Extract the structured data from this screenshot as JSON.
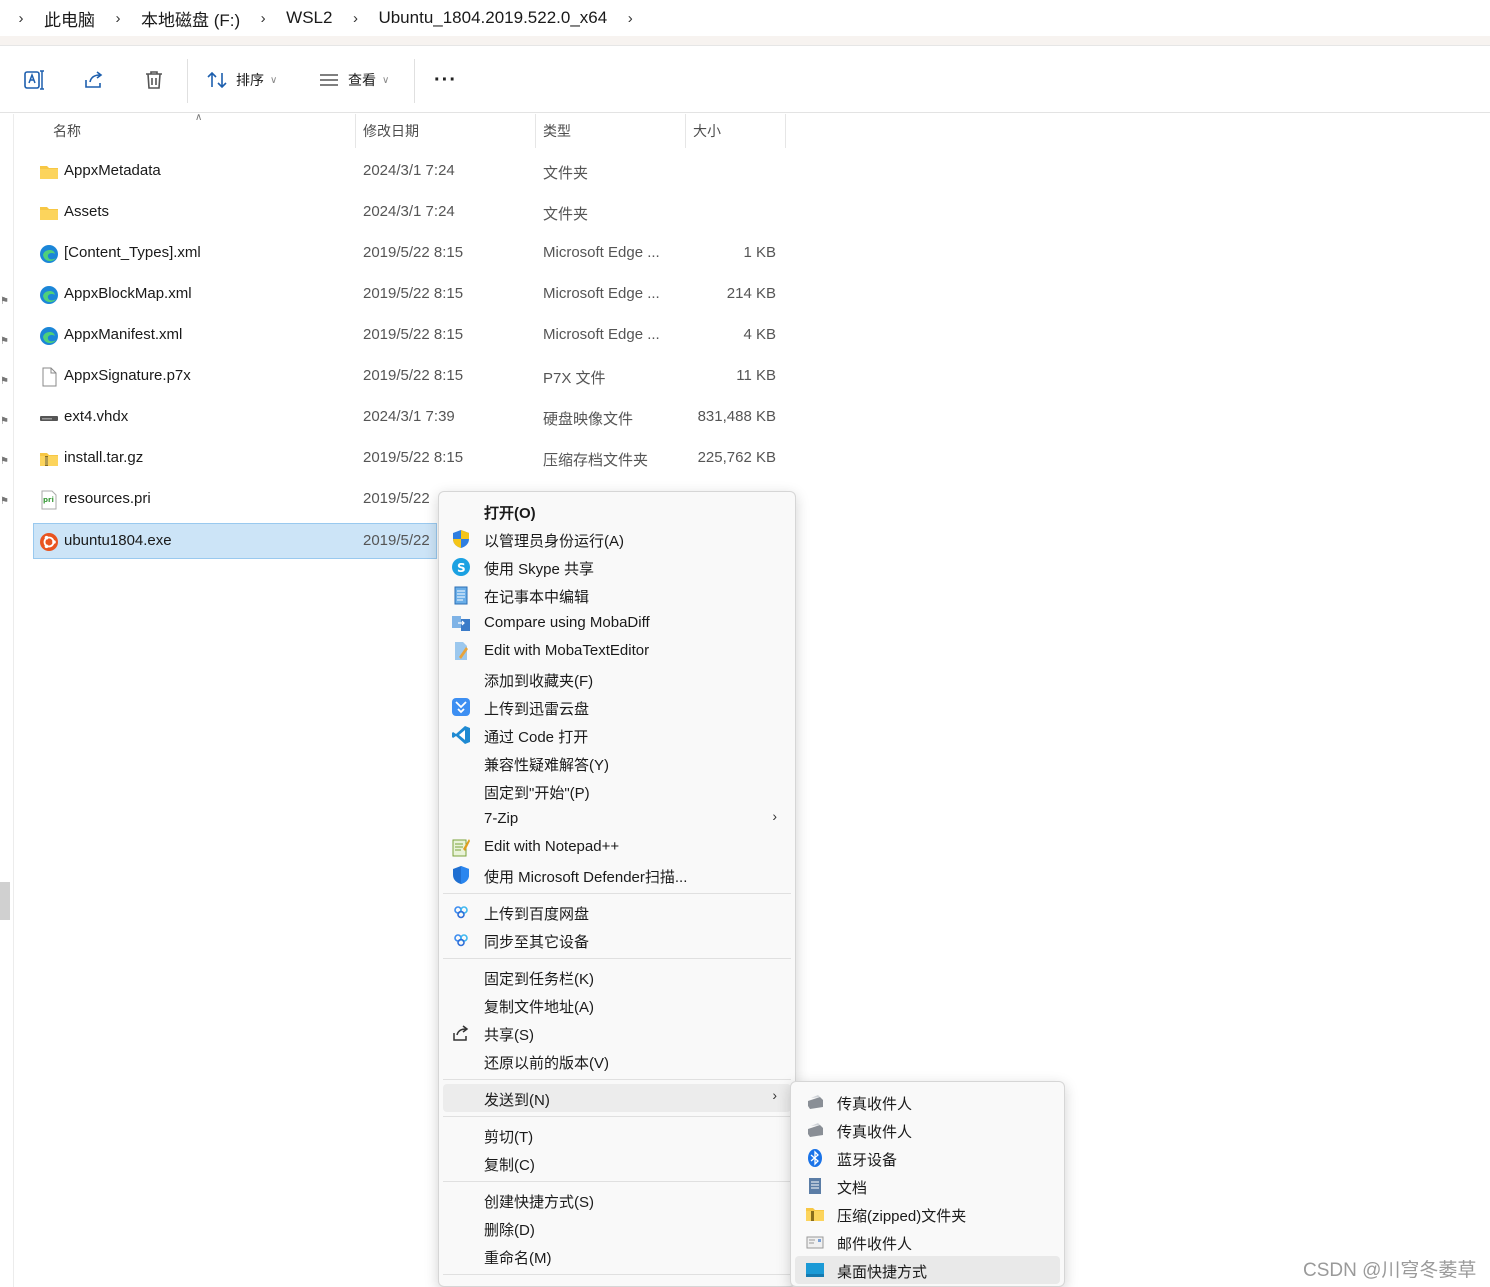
{
  "breadcrumb": {
    "items": [
      "此电脑",
      "本地磁盘 (F:)",
      "WSL2",
      "Ubuntu_1804.2019.522.0_x64"
    ]
  },
  "toolbar": {
    "sort_label": "排序",
    "view_label": "查看",
    "more_label": "···"
  },
  "columns": {
    "name": "名称",
    "date": "修改日期",
    "type": "类型",
    "size": "大小"
  },
  "files": [
    {
      "name": "AppxMetadata",
      "date": "2024/3/1 7:24",
      "type": "文件夹",
      "size": "",
      "icon": "folder-icon"
    },
    {
      "name": "Assets",
      "date": "2024/3/1 7:24",
      "type": "文件夹",
      "size": "",
      "icon": "folder-icon"
    },
    {
      "name": "[Content_Types].xml",
      "date": "2019/5/22 8:15",
      "type": "Microsoft Edge ...",
      "size": "1 KB",
      "icon": "edge-icon"
    },
    {
      "name": "AppxBlockMap.xml",
      "date": "2019/5/22 8:15",
      "type": "Microsoft Edge ...",
      "size": "214 KB",
      "icon": "edge-icon"
    },
    {
      "name": "AppxManifest.xml",
      "date": "2019/5/22 8:15",
      "type": "Microsoft Edge ...",
      "size": "4 KB",
      "icon": "edge-icon"
    },
    {
      "name": "AppxSignature.p7x",
      "date": "2019/5/22 8:15",
      "type": "P7X 文件",
      "size": "11 KB",
      "icon": "file-icon"
    },
    {
      "name": "ext4.vhdx",
      "date": "2024/3/1 7:39",
      "type": "硬盘映像文件",
      "size": "831,488 KB",
      "icon": "disk-icon"
    },
    {
      "name": "install.tar.gz",
      "date": "2019/5/22 8:15",
      "type": "压缩存档文件夹",
      "size": "225,762 KB",
      "icon": "zip-folder-icon"
    },
    {
      "name": "resources.pri",
      "date": "2019/5/22",
      "type": "",
      "size": "",
      "icon": "pri-icon"
    },
    {
      "name": "ubuntu1804.exe",
      "date": "2019/5/22",
      "type": "",
      "size": "",
      "icon": "ubuntu-icon"
    }
  ],
  "context_menu": {
    "open": "打开(O)",
    "run_as_admin": "以管理员身份运行(A)",
    "skype_share": "使用 Skype 共享",
    "notepad_edit": "在记事本中编辑",
    "mobadiff": "Compare using MobaDiff",
    "mobatext": "Edit with MobaTextEditor",
    "add_favorites": "添加到收藏夹(F)",
    "xunlei": "上传到迅雷云盘",
    "vscode": "通过 Code 打开",
    "compat": "兼容性疑难解答(Y)",
    "pin_start": "固定到\"开始\"(P)",
    "sevenzip": "7-Zip",
    "notepadpp": "Edit with Notepad++",
    "defender": "使用 Microsoft Defender扫描...",
    "baidu_upload": "上传到百度网盘",
    "baidu_sync": "同步至其它设备",
    "pin_taskbar": "固定到任务栏(K)",
    "copy_path": "复制文件地址(A)",
    "share": "共享(S)",
    "restore": "还原以前的版本(V)",
    "send_to": "发送到(N)",
    "cut": "剪切(T)",
    "copy": "复制(C)",
    "create_shortcut": "创建快捷方式(S)",
    "delete": "删除(D)",
    "rename": "重命名(M)"
  },
  "send_to_menu": [
    {
      "label": "传真收件人",
      "icon": "fax-icon"
    },
    {
      "label": "传真收件人",
      "icon": "fax-icon"
    },
    {
      "label": "蓝牙设备",
      "icon": "bluetooth-icon"
    },
    {
      "label": "文档",
      "icon": "document-icon"
    },
    {
      "label": "压缩(zipped)文件夹",
      "icon": "zip-folder-icon"
    },
    {
      "label": "邮件收件人",
      "icon": "mail-icon"
    },
    {
      "label": "桌面快捷方式",
      "icon": "desktop-icon"
    }
  ],
  "watermark": "CSDN @川穹冬萎草",
  "colors": {
    "selection": "#cce4f7",
    "accent": "#1d5fae"
  }
}
